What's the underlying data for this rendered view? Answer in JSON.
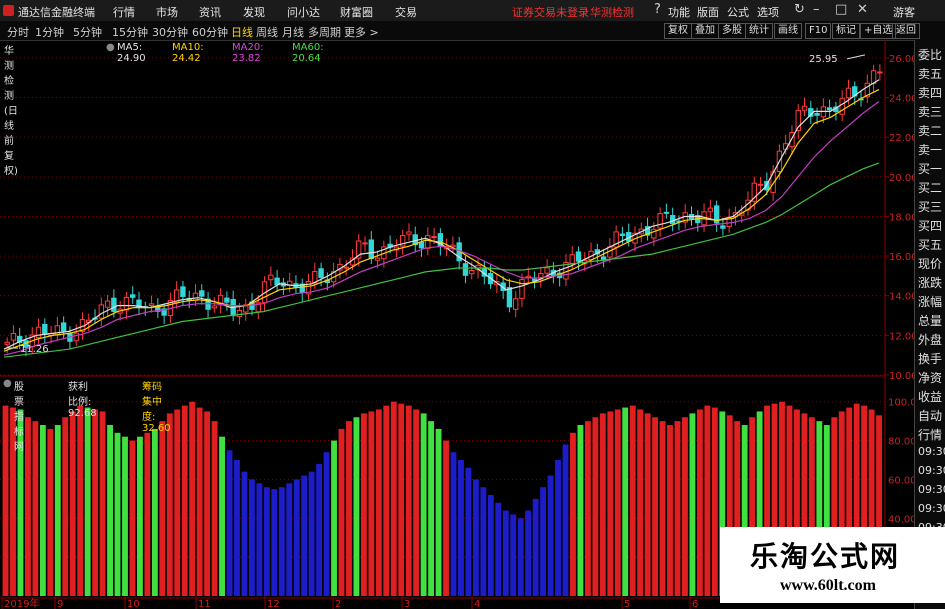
{
  "titlebar": {
    "app_name": "通达信金融终端",
    "menus": [
      "行情",
      "市场",
      "资讯",
      "发现",
      "问小达",
      "财富圈",
      "交易"
    ],
    "notice": "证券交易未登录",
    "stock": "华测检测",
    "tools": [
      "功能",
      "版面",
      "公式",
      "选项"
    ],
    "right_tag": "游客"
  },
  "periods": [
    "分时",
    "1分钟",
    "5分钟",
    "15分钟",
    "30分钟",
    "60分钟",
    "日线",
    "周线",
    "月线",
    "多周期",
    "更多 >"
  ],
  "active_period": "日线",
  "toolbar_right": [
    "复权",
    "叠加",
    "多股",
    "统计",
    "画线",
    "F10",
    "标记",
    "+自选",
    "返回"
  ],
  "main_legend": {
    "title": "华测检测(日线 前复权)",
    "ma": [
      {
        "label": "MA5: 24.90",
        "color": "#e0e0e0"
      },
      {
        "label": "MA10: 24.42",
        "color": "#ffd400"
      },
      {
        "label": "MA20: 23.82",
        "color": "#e040e0"
      },
      {
        "label": "MA60: 20.64",
        "color": "#40e040"
      }
    ]
  },
  "sub_legend": {
    "title": "股票指标网",
    "items": [
      {
        "label": "获利比例: 92.68",
        "color": "#e0e0e0"
      },
      {
        "label": "筹码集中度: 32.60",
        "color": "#ffd400"
      }
    ]
  },
  "price_axis": {
    "ticks": [
      "26.00",
      "24.00",
      "22.00",
      "20.00",
      "18.00",
      "16.00",
      "14.00",
      "12.00",
      "10.00"
    ]
  },
  "indicator_axis": {
    "ticks": [
      "100.00",
      "80.00",
      "60.00",
      "40.00",
      "20.00"
    ]
  },
  "annotations": {
    "high": "25.95",
    "low": "11.26"
  },
  "x_axis": {
    "labels": [
      "2019年",
      "9",
      "10",
      "11",
      "12",
      "2",
      "3",
      "4",
      "5",
      "6"
    ]
  },
  "right_panel": [
    "委比",
    "卖五",
    "卖四",
    "卖三",
    "卖二",
    "卖一",
    "买一",
    "买二",
    "买三",
    "买四",
    "买五",
    "现价",
    "涨跌",
    "涨幅",
    "总量",
    "外盘",
    "换手",
    "净资",
    "收益",
    "自动",
    "行情",
    "09:30",
    "09:30",
    "09:30",
    "09:30",
    "09:30",
    "09:30"
  ],
  "colors": {
    "up": "#e02020",
    "down_green": "#40e040",
    "low_blue": "#1c1cc8",
    "ma5": "#e0e0e0",
    "ma10": "#ffd400",
    "ma20": "#c040c0",
    "ma60": "#40c040",
    "grid": "#7a0000"
  },
  "watermark": {
    "line1": "乐淘公式网",
    "line2": "www.60lt.com"
  },
  "chart_data": [
    {
      "type": "candlestick",
      "title": "华测检测(日线 前复权)",
      "ylim": [
        10,
        26.5
      ],
      "series": [
        {
          "name": "收盘(近似)",
          "values": [
            11.4,
            11.9,
            12.2,
            12.0,
            12.3,
            12.6,
            13.4,
            13.8,
            13.5,
            13.3,
            13.7,
            13.9,
            14.0,
            13.6,
            13.2,
            13.5,
            14.4,
            14.8,
            14.5,
            14.6,
            15.2,
            15.7,
            16.4,
            16.2,
            16.6,
            16.8,
            17.0,
            16.5,
            15.8,
            15.3,
            14.6,
            13.9,
            14.6,
            15.0,
            15.4,
            15.6,
            16.0,
            16.4,
            16.8,
            17.2,
            17.6,
            17.8,
            18.1,
            18.0,
            17.7,
            18.1,
            18.9,
            19.8,
            21.5,
            23.0,
            23.6,
            23.2,
            24.0,
            24.6,
            25.3
          ]
        },
        {
          "name": "MA5",
          "values": [
            11.3,
            11.7,
            12.0,
            12.1,
            12.2,
            12.5,
            13.1,
            13.5,
            13.5,
            13.4,
            13.6,
            13.8,
            13.9,
            13.7,
            13.4,
            13.5,
            14.1,
            14.6,
            14.5,
            14.6,
            15.0,
            15.5,
            16.1,
            16.2,
            16.5,
            16.7,
            16.9,
            16.6,
            16.0,
            15.5,
            14.9,
            14.3,
            14.5,
            14.8,
            15.2,
            15.5,
            15.9,
            16.3,
            16.7,
            17.1,
            17.5,
            17.7,
            18.0,
            18.0,
            17.8,
            18.0,
            18.7,
            19.5,
            21.0,
            22.5,
            23.3,
            23.3,
            23.8,
            24.4,
            24.9
          ]
        },
        {
          "name": "MA10",
          "values": [
            11.2,
            11.5,
            11.8,
            12.0,
            12.1,
            12.3,
            12.8,
            13.2,
            13.4,
            13.4,
            13.5,
            13.7,
            13.8,
            13.7,
            13.5,
            13.5,
            13.9,
            14.3,
            14.4,
            14.5,
            14.8,
            15.2,
            15.7,
            16.0,
            16.3,
            16.5,
            16.8,
            16.7,
            16.3,
            15.8,
            15.3,
            14.8,
            14.6,
            14.7,
            15.0,
            15.3,
            15.7,
            16.1,
            16.5,
            16.9,
            17.2,
            17.5,
            17.8,
            17.9,
            17.8,
            17.9,
            18.4,
            19.1,
            20.3,
            21.7,
            22.7,
            23.0,
            23.5,
            24.0,
            24.4
          ]
        },
        {
          "name": "MA20",
          "values": [
            11.0,
            11.2,
            11.5,
            11.7,
            11.9,
            12.1,
            12.4,
            12.8,
            13.0,
            13.2,
            13.3,
            13.5,
            13.6,
            13.6,
            13.5,
            13.5,
            13.6,
            13.9,
            14.1,
            14.2,
            14.4,
            14.8,
            15.2,
            15.5,
            15.8,
            16.1,
            16.4,
            16.5,
            16.3,
            16.0,
            15.6,
            15.2,
            14.9,
            14.9,
            15.0,
            15.1,
            15.4,
            15.7,
            16.0,
            16.4,
            16.7,
            17.0,
            17.3,
            17.5,
            17.6,
            17.7,
            17.9,
            18.3,
            19.0,
            20.0,
            21.0,
            21.8,
            22.5,
            23.2,
            23.8
          ]
        },
        {
          "name": "MA60",
          "values": [
            10.9,
            11.0,
            11.1,
            11.2,
            11.3,
            11.5,
            11.7,
            11.9,
            12.1,
            12.3,
            12.5,
            12.7,
            12.8,
            12.9,
            13.0,
            13.1,
            13.2,
            13.4,
            13.6,
            13.8,
            14.0,
            14.2,
            14.4,
            14.6,
            14.8,
            15.0,
            15.2,
            15.3,
            15.4,
            15.4,
            15.4,
            15.3,
            15.3,
            15.4,
            15.5,
            15.6,
            15.7,
            15.8,
            15.9,
            16.0,
            16.1,
            16.3,
            16.5,
            16.7,
            16.9,
            17.1,
            17.4,
            17.7,
            18.1,
            18.6,
            19.1,
            19.6,
            20.0,
            20.4,
            20.7
          ]
        }
      ]
    },
    {
      "type": "bar",
      "title": "股票指标网",
      "ylim": [
        0,
        105
      ],
      "series": [
        {
          "name": "获利比例",
          "values": [
            98,
            97,
            96,
            92,
            90,
            88,
            86,
            88,
            92,
            95,
            98,
            97,
            96,
            95,
            88,
            84,
            82,
            80,
            82,
            84,
            86,
            90,
            94,
            96,
            98,
            100,
            97,
            95,
            90,
            82,
            75,
            70,
            64,
            60,
            58,
            56,
            55,
            56,
            58,
            60,
            62,
            64,
            68,
            74,
            80,
            86,
            90,
            92,
            94,
            95,
            96,
            98,
            100,
            99,
            98,
            96,
            94,
            90,
            86,
            80,
            74,
            70,
            66,
            60,
            56,
            52,
            48,
            44,
            42,
            40,
            44,
            50,
            56,
            62,
            70,
            78,
            84,
            88,
            90,
            92,
            94,
            95,
            96,
            97,
            98,
            96,
            94,
            92,
            90,
            88,
            90,
            92,
            94,
            96,
            98,
            97,
            95,
            93,
            90,
            88,
            92,
            95,
            98,
            99,
            100,
            98,
            96,
            94,
            92,
            90,
            88,
            92,
            95,
            97,
            99,
            98,
            96,
            93
          ]
        }
      ]
    }
  ]
}
